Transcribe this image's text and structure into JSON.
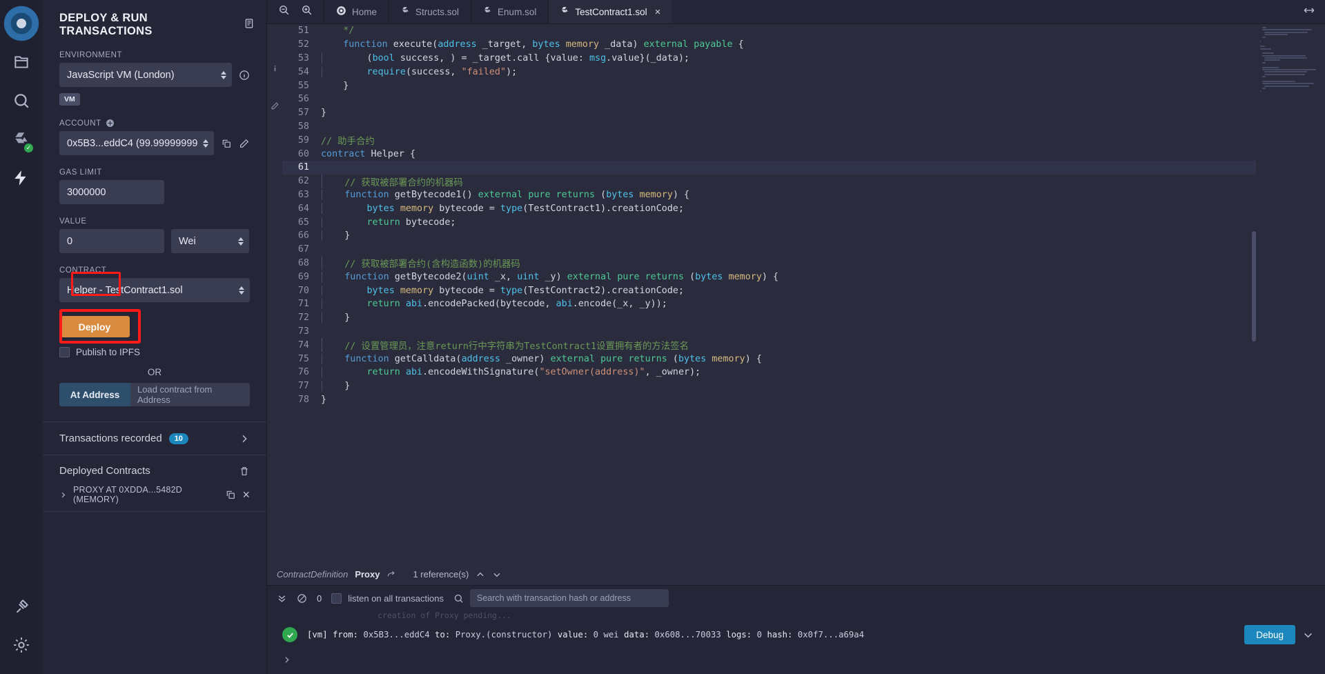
{
  "rail": {
    "items": [
      {
        "name": "remix-logo-icon",
        "label": "Remix"
      },
      {
        "name": "file-explorer-icon",
        "label": "File explorers"
      },
      {
        "name": "search-icon",
        "label": "Search in files"
      },
      {
        "name": "solidity-compiler-icon",
        "label": "Solidity compiler"
      },
      {
        "name": "deploy-run-icon",
        "label": "Deploy & run transactions"
      },
      {
        "name": "plugin-manager-icon",
        "label": "Plugin manager"
      },
      {
        "name": "settings-gear-icon",
        "label": "Settings"
      }
    ]
  },
  "sidebar": {
    "title": "DEPLOY & RUN TRANSACTIONS",
    "header_icon": "document-icon",
    "environment": {
      "label": "ENVIRONMENT",
      "value": "JavaScript VM (London)",
      "info_icon": "info-icon",
      "badge": "VM"
    },
    "account": {
      "label": "ACCOUNT",
      "add_icon": "plus-circle-icon",
      "value": "0x5B3...eddC4 (99.99999999",
      "copy_icon": "copy-icon",
      "edit_icon": "edit-icon"
    },
    "gas_limit": {
      "label": "GAS LIMIT",
      "value": "3000000"
    },
    "value": {
      "label": "VALUE",
      "amount": "0",
      "unit": "Wei"
    },
    "contract": {
      "label": "CONTRACT",
      "selected_name": "Helper",
      "selected_separator": "-",
      "selected_file": "TestContract1.sol"
    },
    "deploy_label": "Deploy",
    "publish_ipfs_label": "Publish to IPFS",
    "or_label": "OR",
    "at_address_label": "At Address",
    "at_address_placeholder": "Load contract from Address",
    "transactions_recorded": {
      "label": "Transactions recorded",
      "count": "10",
      "chevron_icon": "chevron-right-icon"
    },
    "deployed_contracts": {
      "label": "Deployed Contracts",
      "trash_icon": "trash-icon",
      "items": [
        {
          "expand_icon": "chevron-right-icon",
          "name": "PROXY AT 0XDDA...5482D (MEMORY)",
          "copy_icon": "copy-icon",
          "close_icon": "close-icon"
        }
      ]
    }
  },
  "editor": {
    "zoom_out_icon": "zoom-out-icon",
    "zoom_in_icon": "zoom-in-icon",
    "expand_icon": "expand-arrows-icon",
    "tabs": [
      {
        "label": "Home",
        "icon": "remix-home-icon",
        "active": false,
        "closable": false
      },
      {
        "label": "Structs.sol",
        "icon": "solidity-icon",
        "active": false,
        "closable": false
      },
      {
        "label": "Enum.sol",
        "icon": "solidity-icon",
        "active": false,
        "closable": false
      },
      {
        "label": "TestContract1.sol",
        "icon": "solidity-icon",
        "active": true,
        "closable": true
      }
    ],
    "gutter_icons": [
      "info-icon",
      "edit-icon"
    ],
    "current_line": 61,
    "lines": [
      {
        "n": 51,
        "ind": false,
        "tokens": [
          {
            "t": "    ",
            "c": "pl"
          },
          {
            "t": "*/",
            "c": "cm"
          }
        ]
      },
      {
        "n": 52,
        "ind": false,
        "tokens": [
          {
            "t": "    ",
            "c": "pl"
          },
          {
            "t": "function",
            "c": "k"
          },
          {
            "t": " execute(",
            "c": "pl"
          },
          {
            "t": "address",
            "c": "ty"
          },
          {
            "t": " _target, ",
            "c": "pl"
          },
          {
            "t": "bytes",
            "c": "ty"
          },
          {
            "t": " ",
            "c": "pl"
          },
          {
            "t": "memory",
            "c": "yl"
          },
          {
            "t": " _data) ",
            "c": "pl"
          },
          {
            "t": "external",
            "c": "kg"
          },
          {
            "t": " ",
            "c": "pl"
          },
          {
            "t": "payable",
            "c": "kg"
          },
          {
            "t": " {",
            "c": "pl"
          }
        ]
      },
      {
        "n": 53,
        "ind": true,
        "tokens": [
          {
            "t": "        (",
            "c": "pl"
          },
          {
            "t": "bool",
            "c": "ty"
          },
          {
            "t": " success, ) = _target.call {value: ",
            "c": "pl"
          },
          {
            "t": "msg",
            "c": "mg"
          },
          {
            "t": ".value}(_data);",
            "c": "pl"
          }
        ]
      },
      {
        "n": 54,
        "ind": true,
        "tokens": [
          {
            "t": "        ",
            "c": "pl"
          },
          {
            "t": "require",
            "c": "ty"
          },
          {
            "t": "(success, ",
            "c": "pl"
          },
          {
            "t": "\"failed\"",
            "c": "st"
          },
          {
            "t": ");",
            "c": "pl"
          }
        ]
      },
      {
        "n": 55,
        "ind": false,
        "tokens": [
          {
            "t": "    }",
            "c": "pl"
          }
        ]
      },
      {
        "n": 56,
        "ind": false,
        "tokens": []
      },
      {
        "n": 57,
        "ind": false,
        "tokens": [
          {
            "t": "}",
            "c": "pl"
          }
        ]
      },
      {
        "n": 58,
        "ind": false,
        "tokens": []
      },
      {
        "n": 59,
        "ind": false,
        "tokens": [
          {
            "t": "// 助手合约",
            "c": "cm"
          }
        ]
      },
      {
        "n": 60,
        "ind": false,
        "tokens": [
          {
            "t": "contract",
            "c": "k"
          },
          {
            "t": " Helper {",
            "c": "pl"
          }
        ]
      },
      {
        "n": 61,
        "ind": true,
        "tokens": []
      },
      {
        "n": 62,
        "ind": true,
        "tokens": [
          {
            "t": "    // 获取被部署合约的机器码",
            "c": "cm"
          }
        ]
      },
      {
        "n": 63,
        "ind": true,
        "tokens": [
          {
            "t": "    ",
            "c": "pl"
          },
          {
            "t": "function",
            "c": "k"
          },
          {
            "t": " getBytecode1() ",
            "c": "pl"
          },
          {
            "t": "external",
            "c": "kg"
          },
          {
            "t": " ",
            "c": "pl"
          },
          {
            "t": "pure",
            "c": "kg"
          },
          {
            "t": " ",
            "c": "pl"
          },
          {
            "t": "returns",
            "c": "kg"
          },
          {
            "t": " (",
            "c": "pl"
          },
          {
            "t": "bytes",
            "c": "ty"
          },
          {
            "t": " ",
            "c": "pl"
          },
          {
            "t": "memory",
            "c": "yl"
          },
          {
            "t": ") {",
            "c": "pl"
          }
        ]
      },
      {
        "n": 64,
        "ind": true,
        "tokens": [
          {
            "t": "        ",
            "c": "pl"
          },
          {
            "t": "bytes",
            "c": "ty"
          },
          {
            "t": " ",
            "c": "pl"
          },
          {
            "t": "memory",
            "c": "yl"
          },
          {
            "t": " bytecode = ",
            "c": "pl"
          },
          {
            "t": "type",
            "c": "ty"
          },
          {
            "t": "(TestContract1).creationCode;",
            "c": "pl"
          }
        ]
      },
      {
        "n": 65,
        "ind": true,
        "tokens": [
          {
            "t": "        ",
            "c": "pl"
          },
          {
            "t": "return",
            "c": "kg"
          },
          {
            "t": " bytecode;",
            "c": "pl"
          }
        ]
      },
      {
        "n": 66,
        "ind": true,
        "tokens": [
          {
            "t": "    }",
            "c": "pl"
          }
        ]
      },
      {
        "n": 67,
        "ind": true,
        "tokens": []
      },
      {
        "n": 68,
        "ind": true,
        "tokens": [
          {
            "t": "    // 获取被部署合约(含构造函数)的机器码",
            "c": "cm"
          }
        ]
      },
      {
        "n": 69,
        "ind": true,
        "tokens": [
          {
            "t": "    ",
            "c": "pl"
          },
          {
            "t": "function",
            "c": "k"
          },
          {
            "t": " getBytecode2(",
            "c": "pl"
          },
          {
            "t": "uint",
            "c": "ty"
          },
          {
            "t": " _x, ",
            "c": "pl"
          },
          {
            "t": "uint",
            "c": "ty"
          },
          {
            "t": " _y) ",
            "c": "pl"
          },
          {
            "t": "external",
            "c": "kg"
          },
          {
            "t": " ",
            "c": "pl"
          },
          {
            "t": "pure",
            "c": "kg"
          },
          {
            "t": " ",
            "c": "pl"
          },
          {
            "t": "returns",
            "c": "kg"
          },
          {
            "t": " (",
            "c": "pl"
          },
          {
            "t": "bytes",
            "c": "ty"
          },
          {
            "t": " ",
            "c": "pl"
          },
          {
            "t": "memory",
            "c": "yl"
          },
          {
            "t": ") {",
            "c": "pl"
          }
        ]
      },
      {
        "n": 70,
        "ind": true,
        "tokens": [
          {
            "t": "        ",
            "c": "pl"
          },
          {
            "t": "bytes",
            "c": "ty"
          },
          {
            "t": " ",
            "c": "pl"
          },
          {
            "t": "memory",
            "c": "yl"
          },
          {
            "t": " bytecode = ",
            "c": "pl"
          },
          {
            "t": "type",
            "c": "ty"
          },
          {
            "t": "(TestContract2).creationCode;",
            "c": "pl"
          }
        ]
      },
      {
        "n": 71,
        "ind": true,
        "tokens": [
          {
            "t": "        ",
            "c": "pl"
          },
          {
            "t": "return",
            "c": "kg"
          },
          {
            "t": " ",
            "c": "pl"
          },
          {
            "t": "abi",
            "c": "ty"
          },
          {
            "t": ".encodePacked(bytecode, ",
            "c": "pl"
          },
          {
            "t": "abi",
            "c": "ty"
          },
          {
            "t": ".encode(_x, _y));",
            "c": "pl"
          }
        ]
      },
      {
        "n": 72,
        "ind": true,
        "tokens": [
          {
            "t": "    }",
            "c": "pl"
          }
        ]
      },
      {
        "n": 73,
        "ind": true,
        "tokens": []
      },
      {
        "n": 74,
        "ind": true,
        "tokens": [
          {
            "t": "    // 设置管理员，注意return行中字符串为TestContract1设置拥有者的方法签名",
            "c": "cm"
          }
        ]
      },
      {
        "n": 75,
        "ind": true,
        "tokens": [
          {
            "t": "    ",
            "c": "pl"
          },
          {
            "t": "function",
            "c": "k"
          },
          {
            "t": " getCalldata(",
            "c": "pl"
          },
          {
            "t": "address",
            "c": "ty"
          },
          {
            "t": " _owner) ",
            "c": "pl"
          },
          {
            "t": "external",
            "c": "kg"
          },
          {
            "t": " ",
            "c": "pl"
          },
          {
            "t": "pure",
            "c": "kg"
          },
          {
            "t": " ",
            "c": "pl"
          },
          {
            "t": "returns",
            "c": "kg"
          },
          {
            "t": " (",
            "c": "pl"
          },
          {
            "t": "bytes",
            "c": "ty"
          },
          {
            "t": " ",
            "c": "pl"
          },
          {
            "t": "memory",
            "c": "yl"
          },
          {
            "t": ") {",
            "c": "pl"
          }
        ]
      },
      {
        "n": 76,
        "ind": true,
        "tokens": [
          {
            "t": "        ",
            "c": "pl"
          },
          {
            "t": "return",
            "c": "kg"
          },
          {
            "t": " ",
            "c": "pl"
          },
          {
            "t": "abi",
            "c": "ty"
          },
          {
            "t": ".encodeWithSignature(",
            "c": "pl"
          },
          {
            "t": "\"setOwner(address)\"",
            "c": "st"
          },
          {
            "t": ", _owner);",
            "c": "pl"
          }
        ]
      },
      {
        "n": 77,
        "ind": true,
        "tokens": [
          {
            "t": "    }",
            "c": "pl"
          }
        ]
      },
      {
        "n": 78,
        "ind": false,
        "tokens": [
          {
            "t": "}",
            "c": "pl"
          }
        ]
      }
    ]
  },
  "reference_bar": {
    "kind": "ContractDefinition",
    "name": "Proxy",
    "jump_icon": "arrow-jump-icon",
    "references": "1 reference(s)",
    "up_icon": "chevron-up-icon",
    "down_icon": "chevron-down-icon"
  },
  "terminal": {
    "collapse_icon": "chevrons-down-icon",
    "clear_icon": "no-entry-icon",
    "pending_count": "0",
    "listen_label": "listen on all transactions",
    "search_icon": "search-icon",
    "search_placeholder": "Search with transaction hash or address",
    "faded_line": "creation of Proxy pending...",
    "transaction": {
      "status_icon": "check-circle-icon",
      "prefix": "[vm]",
      "from_label": "from:",
      "from": "0x5B3...eddC4",
      "to_label": "to:",
      "to": "Proxy.(constructor)",
      "value_label": "value:",
      "value": "0 wei",
      "data_label": "data:",
      "data": "0x608...70033",
      "logs_label": "logs:",
      "logs": "0",
      "hash_label": "hash:",
      "hash": "0x0f7...a69a4",
      "debug_label": "Debug",
      "chevron_icon": "chevron-down-icon"
    },
    "prompt_icon": "chevron-right-icon"
  },
  "colors": {
    "accent_orange": "#d98c3f",
    "accent_blue": "#1c87bd",
    "highlight_red": "#ff1a1a",
    "success_green": "#2fa84f"
  }
}
